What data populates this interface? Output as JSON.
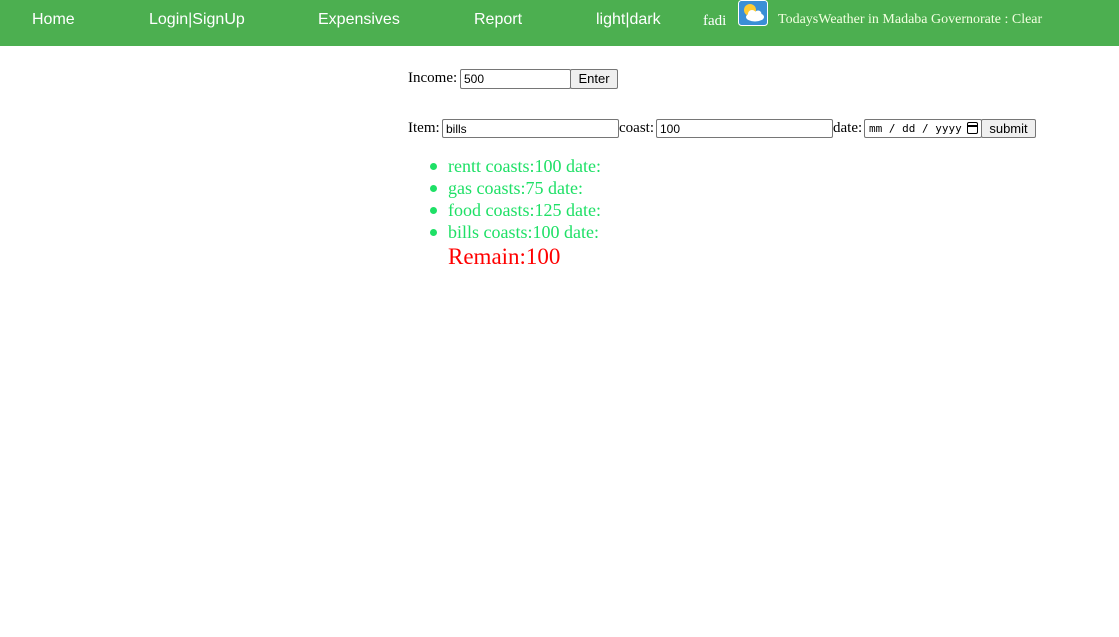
{
  "nav": {
    "home": "Home",
    "login": "Login|SignUp",
    "expensives": "Expensives",
    "report": "Report",
    "theme": "light|dark",
    "user": "fadi",
    "weather_icon": "partly-cloudy-icon",
    "weather_text": "TodaysWeather in Madaba Governorate : Clear"
  },
  "income": {
    "label": "Income:",
    "value": "500",
    "button": "Enter"
  },
  "expense_form": {
    "item_label": "Item:",
    "item_value": "bills",
    "coast_label": "coast:",
    "coast_value": "100",
    "date_label": "date:",
    "date_placeholder": "mm / dd / yyyy",
    "submit": "submit"
  },
  "items": [
    {
      "text": "rentt coasts:100 date:"
    },
    {
      "text": "gas coasts:75 date:"
    },
    {
      "text": "food coasts:125 date:"
    },
    {
      "text": "bills coasts:100 date:"
    }
  ],
  "remain": "Remain:100",
  "colors": {
    "navbar": "#4caf50",
    "list_text": "#1ee066",
    "remain_text": "#ff0000"
  }
}
